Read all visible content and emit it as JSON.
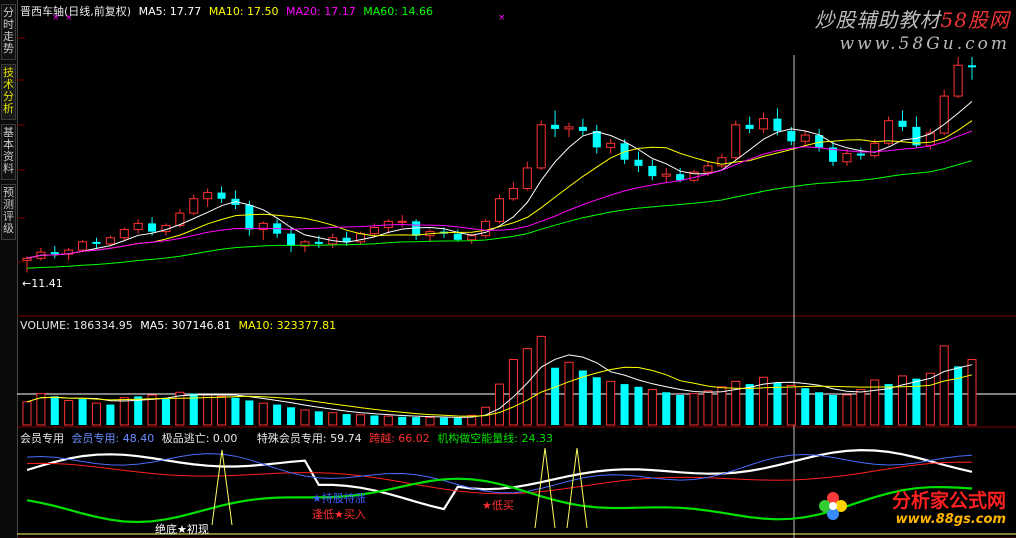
{
  "tabs": [
    {
      "label": "分时走势",
      "active": false
    },
    {
      "label": "技术分析",
      "active": true
    },
    {
      "label": "基本资料",
      "active": false
    },
    {
      "label": "预测评级",
      "active": false
    }
  ],
  "price_panel": {
    "title": "晋西车轴(日线,前复权)",
    "ma5": "MA5: 17.77",
    "ma10": "MA10: 17.50",
    "ma20": "MA20: 17.17",
    "ma60": "MA60: 14.66",
    "low_marker": "←11.41"
  },
  "volume_panel": {
    "volume": "VOLUME: 186334.95",
    "ma5": "MA5: 307146.81",
    "ma10": "MA10: 323377.81"
  },
  "indicator_panel": {
    "name": "会员专用",
    "member": "会员专用: 48.40",
    "escape": "极品逃亡: 0.00",
    "special": "特殊会员专用: 59.74",
    "jump": "跨越: 66.02",
    "inst": "机构做空能量线: 24.33",
    "ann_bottom": "绝底★初现",
    "ann_low_buy": "逢低★买入",
    "ann_hold": "★持股待涨",
    "ann_low_buy2": "★低买"
  },
  "watermark_top": {
    "brand": "炒股辅助教材",
    "brand_accent": "58股网",
    "url": "www.58Gu.com"
  },
  "watermark_bottom": {
    "brand": "分析家公式网",
    "url": "www.88gs.com"
  },
  "colors": {
    "up": "#ff3232",
    "down": "#00ffff",
    "ma5": "#ffffff",
    "ma10": "#ffff00",
    "ma20": "#ff00ff",
    "ma60": "#00ff00",
    "grid": "#800000"
  },
  "chart_data": {
    "type": "candlestick",
    "candles": [
      [
        12.0,
        12.2,
        11.41,
        12.1
      ],
      [
        12.1,
        12.6,
        12.0,
        12.4
      ],
      [
        12.4,
        12.7,
        12.1,
        12.3
      ],
      [
        12.3,
        12.6,
        12.0,
        12.5
      ],
      [
        12.5,
        13.0,
        12.4,
        12.9
      ],
      [
        12.9,
        13.1,
        12.6,
        12.8
      ],
      [
        12.8,
        13.2,
        12.7,
        13.1
      ],
      [
        13.1,
        13.6,
        13.0,
        13.5
      ],
      [
        13.5,
        14.0,
        13.3,
        13.8
      ],
      [
        13.8,
        14.1,
        13.2,
        13.4
      ],
      [
        13.4,
        13.8,
        13.2,
        13.7
      ],
      [
        13.7,
        14.5,
        13.6,
        14.3
      ],
      [
        14.3,
        15.2,
        14.2,
        15.0
      ],
      [
        15.0,
        15.5,
        14.6,
        15.3
      ],
      [
        15.3,
        15.6,
        14.8,
        15.0
      ],
      [
        15.0,
        15.4,
        14.5,
        14.7
      ],
      [
        14.7,
        14.9,
        13.2,
        13.5
      ],
      [
        13.5,
        13.9,
        13.0,
        13.8
      ],
      [
        13.8,
        14.0,
        13.1,
        13.3
      ],
      [
        13.3,
        13.6,
        12.4,
        12.7
      ],
      [
        12.7,
        13.0,
        12.4,
        12.9
      ],
      [
        12.9,
        13.2,
        12.6,
        12.8
      ],
      [
        12.8,
        13.3,
        12.6,
        13.1
      ],
      [
        13.1,
        13.4,
        12.7,
        12.9
      ],
      [
        12.9,
        13.4,
        12.8,
        13.3
      ],
      [
        13.3,
        13.8,
        13.1,
        13.6
      ],
      [
        13.6,
        14.0,
        13.3,
        13.9
      ],
      [
        13.9,
        14.2,
        13.6,
        13.9
      ],
      [
        13.9,
        14.0,
        13.0,
        13.2
      ],
      [
        13.2,
        13.5,
        12.9,
        13.4
      ],
      [
        13.4,
        13.6,
        13.1,
        13.3
      ],
      [
        13.3,
        13.5,
        12.9,
        13.0
      ],
      [
        13.0,
        13.3,
        12.8,
        13.2
      ],
      [
        13.2,
        14.0,
        13.1,
        13.9
      ],
      [
        13.9,
        15.2,
        13.8,
        15.0
      ],
      [
        15.0,
        15.8,
        14.9,
        15.5
      ],
      [
        15.5,
        16.8,
        15.4,
        16.5
      ],
      [
        16.5,
        18.8,
        16.4,
        18.6
      ],
      [
        18.6,
        19.3,
        18.0,
        18.4
      ],
      [
        18.4,
        18.7,
        18.0,
        18.5
      ],
      [
        18.5,
        18.9,
        18.1,
        18.3
      ],
      [
        18.3,
        18.6,
        17.2,
        17.5
      ],
      [
        17.5,
        17.9,
        17.2,
        17.7
      ],
      [
        17.7,
        17.9,
        16.7,
        16.9
      ],
      [
        16.9,
        17.3,
        16.3,
        16.6
      ],
      [
        16.6,
        16.9,
        15.9,
        16.1
      ],
      [
        16.1,
        16.5,
        15.8,
        16.2
      ],
      [
        16.2,
        16.5,
        15.8,
        15.9
      ],
      [
        15.9,
        16.4,
        15.8,
        16.3
      ],
      [
        16.3,
        16.8,
        16.1,
        16.6
      ],
      [
        16.6,
        17.2,
        16.5,
        17.0
      ],
      [
        17.0,
        18.8,
        16.9,
        18.6
      ],
      [
        18.6,
        19.0,
        18.2,
        18.4
      ],
      [
        18.4,
        19.2,
        18.2,
        18.9
      ],
      [
        18.9,
        19.4,
        18.1,
        18.3
      ],
      [
        18.3,
        18.5,
        17.6,
        17.8
      ],
      [
        17.8,
        18.3,
        17.5,
        18.1
      ],
      [
        18.1,
        18.4,
        17.3,
        17.5
      ],
      [
        17.5,
        17.8,
        16.6,
        16.8
      ],
      [
        16.8,
        17.4,
        16.6,
        17.2
      ],
      [
        17.2,
        17.5,
        16.9,
        17.1
      ],
      [
        17.1,
        17.9,
        17.0,
        17.7
      ],
      [
        17.7,
        19.0,
        17.6,
        18.8
      ],
      [
        18.8,
        19.3,
        18.3,
        18.5
      ],
      [
        18.5,
        19.0,
        17.5,
        17.6
      ],
      [
        17.6,
        18.4,
        17.4,
        18.2
      ],
      [
        18.2,
        20.3,
        18.1,
        20.0
      ],
      [
        20.0,
        21.9,
        19.9,
        21.5
      ],
      [
        21.5,
        21.9,
        20.8,
        21.4
      ]
    ],
    "volume": [
      [
        1,
        170000
      ],
      [
        1,
        230000
      ],
      [
        0,
        210000
      ],
      [
        1,
        180000
      ],
      [
        0,
        190000
      ],
      [
        1,
        160000
      ],
      [
        0,
        150000
      ],
      [
        1,
        200000
      ],
      [
        0,
        210000
      ],
      [
        1,
        220000
      ],
      [
        0,
        200000
      ],
      [
        1,
        240000
      ],
      [
        0,
        230000
      ],
      [
        1,
        220000
      ],
      [
        1,
        210000
      ],
      [
        0,
        200000
      ],
      [
        0,
        180000
      ],
      [
        1,
        160000
      ],
      [
        0,
        150000
      ],
      [
        0,
        130000
      ],
      [
        1,
        110000
      ],
      [
        0,
        100000
      ],
      [
        1,
        90000
      ],
      [
        0,
        80000
      ],
      [
        1,
        75000
      ],
      [
        0,
        70000
      ],
      [
        1,
        65000
      ],
      [
        0,
        60000
      ],
      [
        0,
        58000
      ],
      [
        1,
        56000
      ],
      [
        0,
        54000
      ],
      [
        0,
        52000
      ],
      [
        1,
        70000
      ],
      [
        1,
        130000
      ],
      [
        1,
        300000
      ],
      [
        1,
        480000
      ],
      [
        1,
        560000
      ],
      [
        1,
        650000
      ],
      [
        0,
        420000
      ],
      [
        1,
        460000
      ],
      [
        0,
        400000
      ],
      [
        0,
        350000
      ],
      [
        1,
        320000
      ],
      [
        0,
        300000
      ],
      [
        0,
        280000
      ],
      [
        1,
        260000
      ],
      [
        0,
        240000
      ],
      [
        0,
        220000
      ],
      [
        1,
        230000
      ],
      [
        1,
        250000
      ],
      [
        1,
        280000
      ],
      [
        1,
        320000
      ],
      [
        0,
        300000
      ],
      [
        1,
        350000
      ],
      [
        0,
        310000
      ],
      [
        1,
        290000
      ],
      [
        0,
        270000
      ],
      [
        0,
        240000
      ],
      [
        0,
        220000
      ],
      [
        1,
        220000
      ],
      [
        1,
        260000
      ],
      [
        1,
        330000
      ],
      [
        0,
        300000
      ],
      [
        1,
        360000
      ],
      [
        0,
        340000
      ],
      [
        1,
        380000
      ],
      [
        1,
        580000
      ],
      [
        0,
        430000
      ],
      [
        1,
        480000
      ]
    ]
  }
}
